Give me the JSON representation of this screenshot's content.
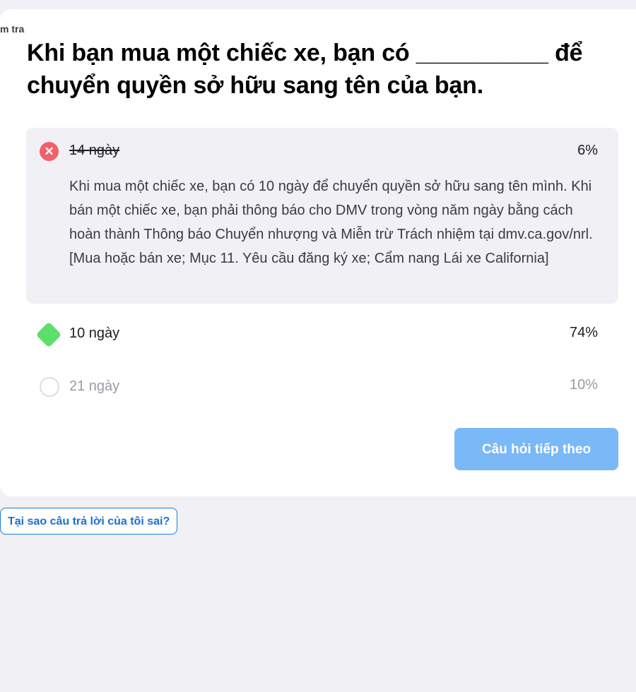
{
  "header": {
    "kicker": "m tra"
  },
  "question": {
    "text": "Khi bạn mua một chiếc xe, bạn có __________ để chuyển quyền sở hữu sang tên của bạn."
  },
  "options": [
    {
      "label": "14 ngày",
      "percent": "6%",
      "state": "wrong",
      "icon": "x-circle-icon",
      "explanation": "Khi mua một chiếc xe, bạn có 10 ngày để chuyển quyền sở hữu sang tên mình. Khi bán một chiếc xe, bạn phải thông báo cho DMV trong vòng năm ngày bằng cách hoàn thành Thông báo Chuyển nhượng và Miễn trừ Trách nhiệm tại dmv.ca.gov/nrl. [Mua hoặc bán xe; Mục 11. Yêu cầu đăng ký xe; Cẩm nang Lái xe California]"
    },
    {
      "label": "10 ngày",
      "percent": "74%",
      "state": "correct",
      "icon": "diamond-icon"
    },
    {
      "label": "21 ngày",
      "percent": "10%",
      "state": "neutral",
      "icon": "circle-icon"
    }
  ],
  "actions": {
    "next_label": "Câu hỏi tiếp theo",
    "why_label": "Tại sao câu trả lời của tôi sai?"
  },
  "colors": {
    "wrong": "#f2606a",
    "correct": "#5ce06a",
    "primary_button": "#7ab8f7",
    "link": "#1a6fd0",
    "background": "#f0f0f5"
  }
}
